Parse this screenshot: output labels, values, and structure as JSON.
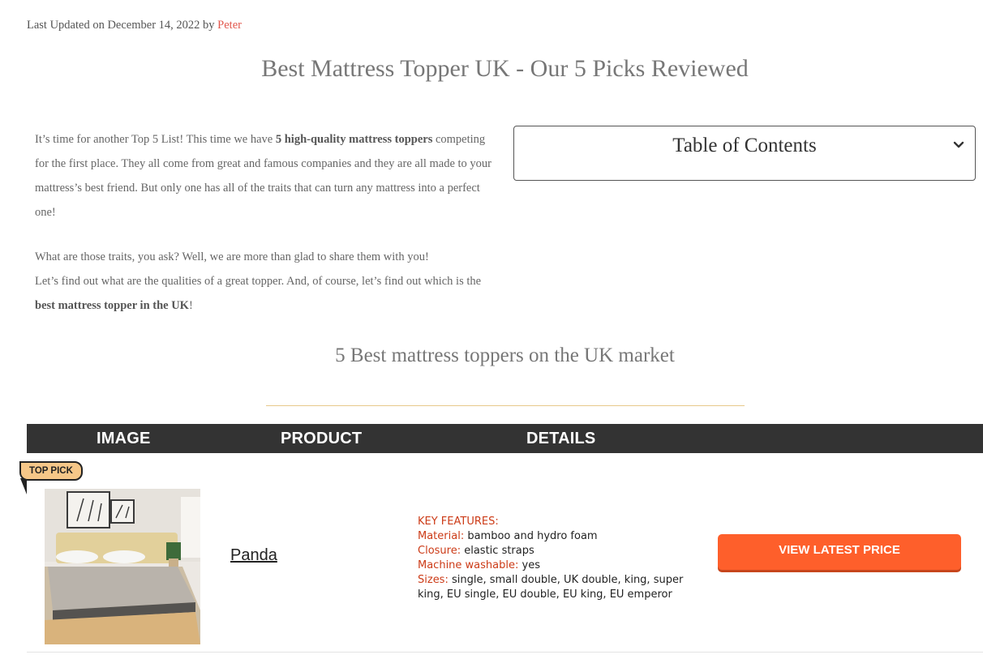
{
  "meta": {
    "updated_text": "Last Updated on December 14, 2022 by",
    "author": "Peter"
  },
  "page_title": "Best Mattress Topper UK - Our 5 Picks Reviewed",
  "intro": {
    "p1_a": "It’s time for another Top 5 List! This time we have ",
    "p1_bold": "5 high-quality mattress toppers",
    "p1_b": " competing for the first place. They all come from great and famous companies and they are all made to your mattress’s best friend. But only one has all of the traits that can turn any mattress into a perfect one!",
    "p2_line1": "What are those traits, you ask? Well, we are more than glad to share them with you!",
    "p2_a": "Let’s find out what are the qualities of a great topper. And, of course, let’s find out which is the ",
    "p2_bold": "best mattress topper in the UK",
    "p2_b": "!"
  },
  "toc": {
    "title": "Table of Contents",
    "icon": "chevron-down-icon"
  },
  "section_title": "5 Best mattress toppers on the UK market",
  "table": {
    "headers": {
      "image": "IMAGE",
      "product": "PRODUCT",
      "details": "DETAILS"
    },
    "rows": [
      {
        "badge": "TOP PICK",
        "product": "Panda",
        "features_heading": "KEY FEATURES:",
        "material_label": "Material:",
        "material": " bamboo and hydro foam",
        "closure_label": "Closure:",
        "closure": " elastic straps",
        "washable_label": "Machine washable:",
        "washable": " yes",
        "sizes_label": "Sizes:",
        "sizes": " single, small double, UK double, king, super king, EU single, EU double, EU king, EU emperor",
        "cta": "VIEW LATEST PRICE"
      }
    ]
  },
  "colors": {
    "accent": "#fe5f2b",
    "label_red": "#cc3b17",
    "header_bg": "#333333",
    "badge_bg": "#f6c788",
    "author_link": "#e2574c"
  }
}
